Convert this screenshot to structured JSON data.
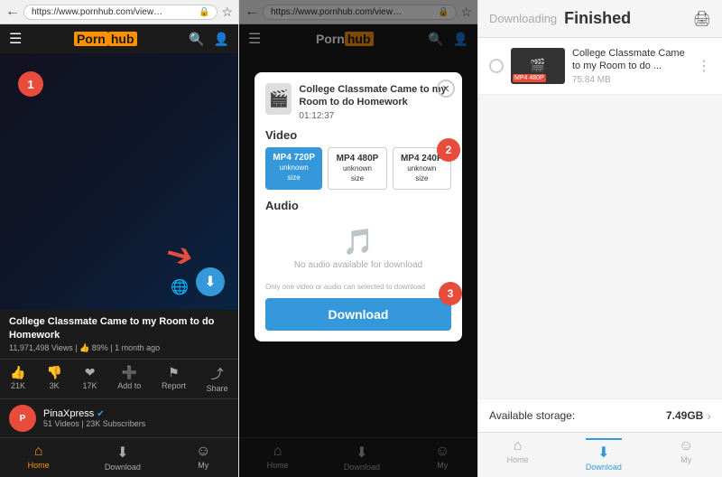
{
  "panel1": {
    "url": "https://www.pornhub.com/view_video.php?vi=...",
    "logo_text": "Porn",
    "logo_highlight": "hub",
    "video_title": "College Classmate Came to my Room to do Homework",
    "video_views": "11,971,498 Views",
    "video_rating": "👍 89%",
    "video_age": "1 month ago",
    "actions": [
      {
        "icon": "👍",
        "label": "21K"
      },
      {
        "icon": "👎",
        "label": "3K"
      },
      {
        "icon": "❤",
        "label": "17K"
      },
      {
        "icon": "＋",
        "label": "Add to"
      },
      {
        "icon": "⚑",
        "label": "Report"
      },
      {
        "icon": "⤴",
        "label": "Share"
      }
    ],
    "channel_name": "PinaXpress",
    "channel_meta": "51 Videos | 23K Subscribers",
    "step_badge": "1",
    "nav_items": [
      {
        "icon": "⌂",
        "label": "Home",
        "active": true
      },
      {
        "icon": "⬇",
        "label": "Download",
        "active": false
      },
      {
        "icon": "☺",
        "label": "My",
        "active": false
      }
    ]
  },
  "panel2": {
    "url": "https://www.pornhub.com/view_video.php?vi=...",
    "popup": {
      "video_title": "College Classmate Came to my Room to do Homework",
      "duration": "01:12:37",
      "section_video": "Video",
      "section_audio": "Audio",
      "quality_options": [
        {
          "label": "MP4 720P",
          "sub": "unknown size",
          "selected": true
        },
        {
          "label": "MP4 480P",
          "sub": "unknown size",
          "selected": false
        },
        {
          "label": "MP4 240P",
          "sub": "unknown size",
          "selected": false
        }
      ],
      "no_audio_text": "No audio available for download",
      "note": "Only one video or audio can selected to download",
      "download_btn": "Download",
      "step2_badge": "2",
      "step3_badge": "3"
    },
    "nav_items": [
      {
        "icon": "⌂",
        "label": "Home",
        "active": false
      },
      {
        "icon": "⬇",
        "label": "Download",
        "active": false
      },
      {
        "icon": "☺",
        "label": "My",
        "active": false
      }
    ]
  },
  "panel3": {
    "header_downloading": "Downloading",
    "header_finished": "Finished",
    "header_icon": "🖨",
    "download_item": {
      "thumb_label": "MP4 480P",
      "title": "College Classmate Came to my Room to do ...",
      "size": "75.84 MB"
    },
    "storage_label": "Available storage:",
    "storage_value": "7.49GB",
    "nav_items": [
      {
        "icon": "⌂",
        "label": "Home",
        "active": false
      },
      {
        "icon": "⬇",
        "label": "Download",
        "active": true
      },
      {
        "icon": "☺",
        "label": "My",
        "active": false
      }
    ]
  }
}
